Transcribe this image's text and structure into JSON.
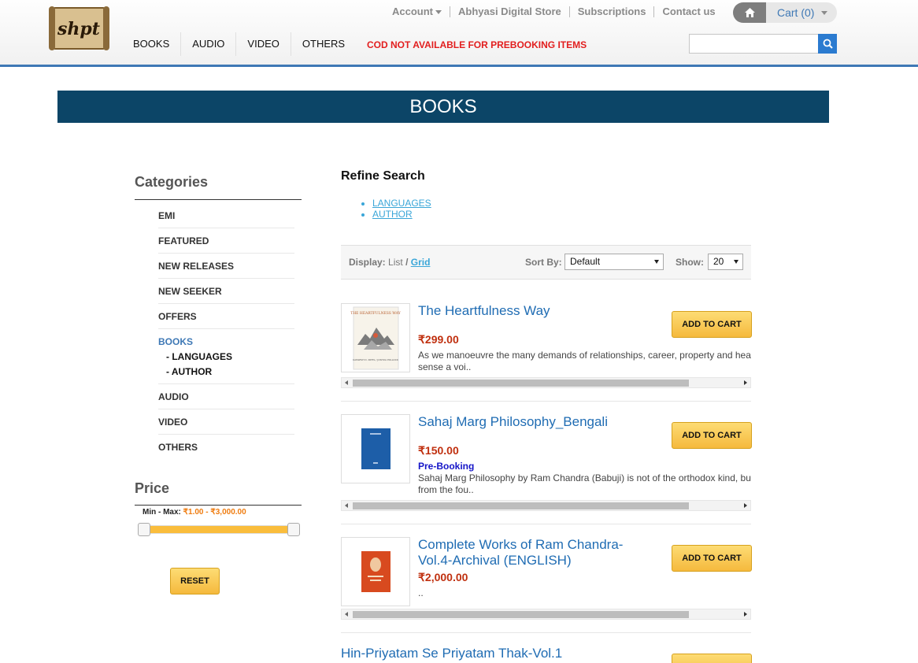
{
  "header": {
    "logo_text": "shpt",
    "top_links": [
      "Account",
      "Abhyasi Digital Store",
      "Subscriptions",
      "Contact us"
    ],
    "cart_label": "Cart (0)",
    "nav": [
      "BOOKS",
      "AUDIO",
      "VIDEO",
      "OTHERS"
    ],
    "notice": "COD NOT AVAILABLE FOR PREBOOKING ITEMS",
    "search": {
      "value": "",
      "placeholder": ""
    }
  },
  "banner": {
    "title": "BOOKS"
  },
  "sidebar": {
    "categories_title": "Categories",
    "categories": [
      {
        "label": "EMI"
      },
      {
        "label": "FEATURED"
      },
      {
        "label": "NEW RELEASES"
      },
      {
        "label": "NEW SEEKER"
      },
      {
        "label": "OFFERS"
      },
      {
        "label": "BOOKS",
        "active": true,
        "sub": [
          "- LANGUAGES",
          "- AUTHOR"
        ]
      },
      {
        "label": "AUDIO"
      },
      {
        "label": "VIDEO"
      },
      {
        "label": "OTHERS"
      }
    ],
    "price_title": "Price",
    "price_minmax_label": "Min - Max:",
    "price_range": "₹1.00 - ₹3,000.00",
    "reset_label": "RESET"
  },
  "refine": {
    "title": "Refine Search",
    "links": [
      "LANGUAGES",
      "AUTHOR"
    ]
  },
  "toolbar": {
    "display_label": "Display:",
    "list_label": "List",
    "slash": "/",
    "grid_label": "Grid",
    "sort_label": "Sort By:",
    "sort_value": "Default",
    "show_label": "Show:",
    "show_value": "20"
  },
  "products": [
    {
      "name": "The Heartfulness Way",
      "price": "₹299.00",
      "prebooking": "",
      "desc_line1": "As we manoeuvre the many demands of relationships, career, property and hea",
      "desc_line2": "sense a voi..",
      "cover_title": "THE HEARTFULNESS WAY",
      "cover_authors": "KAMLESH D. PATEL / JOSHUA POLLOCK",
      "add_to_cart": "ADD TO CART"
    },
    {
      "name": "Sahaj Marg Philosophy_Bengali",
      "price": "₹150.00",
      "prebooking": "Pre-Booking",
      "desc_line1": "Sahaj Marg Philosophy by Ram Chandra (Babuji) is not of the orthodox kind, bu",
      "desc_line2": "from the fou..",
      "add_to_cart": "ADD TO CART"
    },
    {
      "name": "Complete Works of Ram Chandra-Vol.4-Archival (ENGLISH)",
      "price": "₹2,000.00",
      "prebooking": "",
      "desc_line1": "..",
      "desc_line2": "",
      "add_to_cart": "ADD TO CART"
    },
    {
      "name": "Hin-Priyatam Se Priyatam Thak-Vol.1",
      "price": "",
      "prebooking": "",
      "desc_line1": "",
      "desc_line2": "",
      "add_to_cart": ""
    }
  ]
}
